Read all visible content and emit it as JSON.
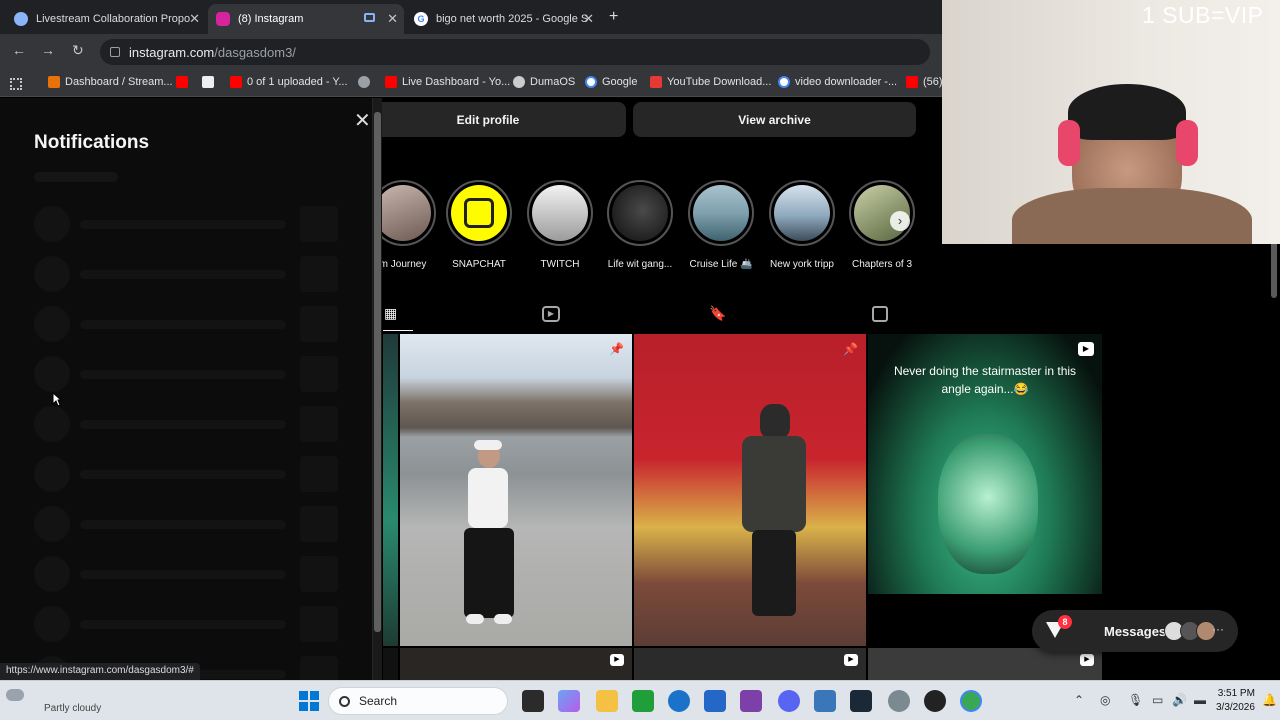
{
  "browser": {
    "tabs": [
      {
        "label": "Livestream Collaboration Propo",
        "active": false
      },
      {
        "label": "(8) Instagram",
        "active": true
      },
      {
        "label": "bigo net worth 2025 - Google S",
        "active": false
      }
    ],
    "new_tab": "+",
    "address": {
      "site": "instagram.com",
      "path": "/dasgasdom3/"
    },
    "bookmarks": [
      "Dashboard / Stream...",
      "0 of 1 uploaded - Y...",
      "Live Dashboard - Yo...",
      "DumaOS",
      "Google",
      "YouTube Download...",
      "video downloader -...",
      "(56)"
    ],
    "status_url": "https://www.instagram.com/dasgasdom3/#"
  },
  "notifications": {
    "title": "Notifications"
  },
  "profile": {
    "edit_profile": "Edit profile",
    "view_archive": "View archive",
    "highlights": [
      {
        "label": "m Journey",
        "color": "#7a6f6a"
      },
      {
        "label": "SNAPCHAT",
        "color": "#fffc00"
      },
      {
        "label": "TWITCH",
        "color": "#d8d8d8"
      },
      {
        "label": "Life wit gang...",
        "color": "#2a2a2a"
      },
      {
        "label": "Cruise Life 🚢",
        "color": "#6e8e9c"
      },
      {
        "label": "New york tripp",
        "color": "#8ea4b8"
      },
      {
        "label": "Chapters of 3",
        "color": "#55604a"
      }
    ],
    "posts": [
      {
        "caption": ""
      },
      {
        "caption": ""
      },
      {
        "caption": "Never doing the  stairmaster in this angle again...😂"
      }
    ]
  },
  "messages": {
    "label": "Messages",
    "badge": "8"
  },
  "overlay": {
    "text": "1 SUB=VIP"
  },
  "taskbar": {
    "search_label": "Search",
    "weather": "Partly cloudy",
    "time": "3:51 PM",
    "date": "3/3/2026"
  }
}
